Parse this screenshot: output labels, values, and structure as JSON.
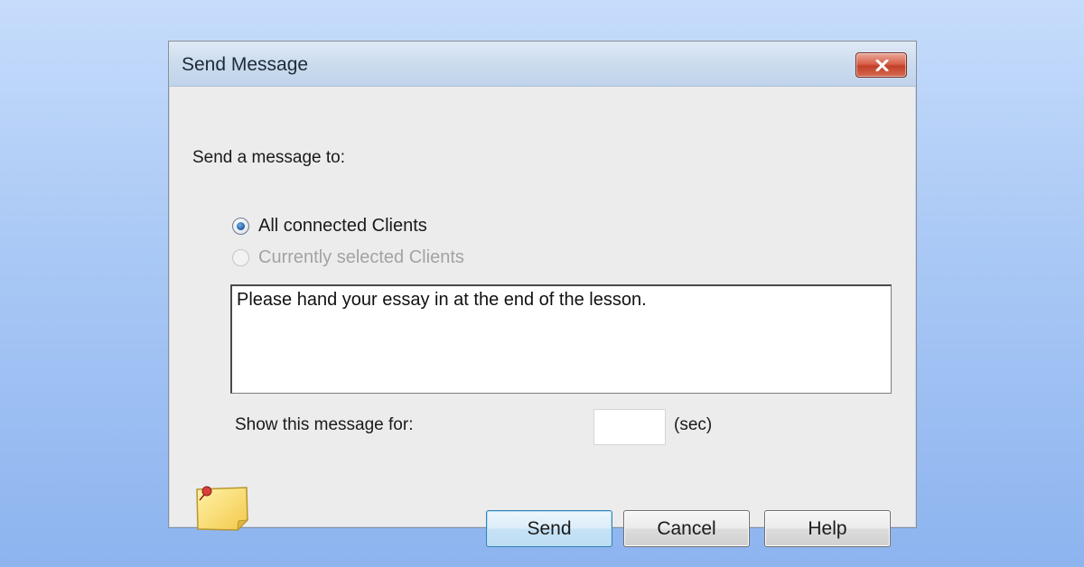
{
  "window": {
    "title": "Send Message",
    "close_icon": "close-icon"
  },
  "form": {
    "send_to_label": "Send a message to:",
    "recipients": [
      {
        "label": "All connected Clients",
        "checked": true,
        "enabled": true
      },
      {
        "label": "Currently selected Clients",
        "checked": false,
        "enabled": false
      }
    ],
    "message_text": "Please hand your essay in at the end of the lesson.",
    "duration_label": "Show this message for:",
    "duration_value": "",
    "duration_unit": "(sec)"
  },
  "buttons": {
    "send_label": "Send",
    "cancel_label": "Cancel",
    "help_label": "Help"
  },
  "icons": {
    "message_icon": "sticky-note-icon"
  },
  "colors": {
    "background_top": "#c6dcfb",
    "background_bottom": "#8db4ef",
    "close_button": "#c3402a",
    "default_button_border": "#3c7fb1"
  }
}
